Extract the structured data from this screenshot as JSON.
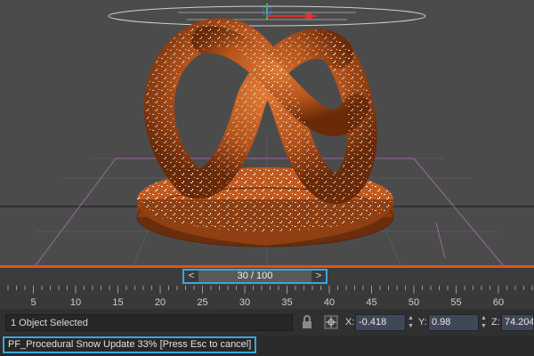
{
  "time_slider": {
    "frame_label": "30 / 100",
    "prev_icon": "<",
    "next_icon": ">"
  },
  "timeline_ruler": {
    "ticks": [
      "5",
      "10",
      "15",
      "20",
      "25",
      "30",
      "35",
      "40",
      "45",
      "50",
      "55",
      "60"
    ]
  },
  "status": {
    "selection_text": "1 Object Selected",
    "x_label": "X:",
    "x_value": "-0.418",
    "y_label": "Y:",
    "y_value": "0.98",
    "z_label": "Z:",
    "z_value": "74.204"
  },
  "prompt": {
    "text": "PF_Procedural Snow Update 33% [Press Esc to cancel]"
  },
  "colors": {
    "viewport_bg": "#4b4b4b",
    "object_orange": "#c25a1e",
    "snow": "#ffffff",
    "accent_blue": "#3aa6e0",
    "timeline_red": "#e0531c"
  },
  "icons": {
    "lock": "lock-icon",
    "coord_mode": "absolute-mode-icon"
  }
}
